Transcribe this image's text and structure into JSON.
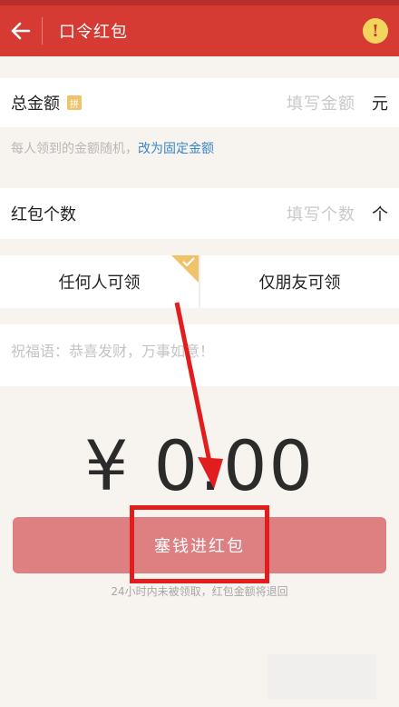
{
  "app_bar": {
    "title": "口令红包",
    "back_icon": "arrow-left-icon",
    "alert_icon": "exclamation-icon",
    "alert_glyph": "!"
  },
  "total_amount": {
    "label": "总金额",
    "badge": "拼",
    "placeholder": "填写金额",
    "unit": "元"
  },
  "amount_hint": {
    "text": "每人领到的金额随机，",
    "link": "改为固定金额"
  },
  "packet_count": {
    "label": "红包个数",
    "placeholder": "填写个数",
    "unit": "个"
  },
  "audience_tabs": [
    {
      "label": "任何人可领",
      "selected": true
    },
    {
      "label": "仅朋友可领",
      "selected": false
    }
  ],
  "blessing": {
    "placeholder": "祝福语：恭喜发财，万事如意！"
  },
  "amount_display": "¥ 0.00",
  "submit_button": {
    "label": "塞钱进红包"
  },
  "note": "24小时内未被领取，红包金额将退回",
  "colors": {
    "app_bar": "#d63b33",
    "button": "#de8082",
    "highlight": "#e11d1d",
    "link": "#3a86c8"
  }
}
